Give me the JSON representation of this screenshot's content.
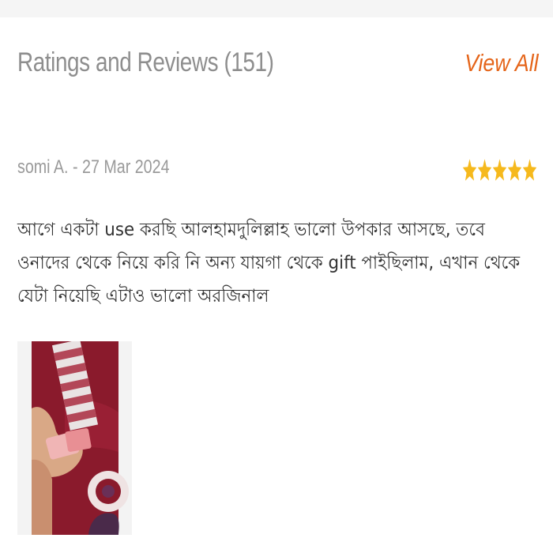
{
  "reviews_section": {
    "title": "Ratings and Reviews (151)",
    "view_all_label": "View All"
  },
  "review": {
    "reviewer_line": "somi A. - 27 Mar 2024",
    "rating": 5,
    "rating_max": 5,
    "star_color": "#f6b91c",
    "text": "আগে একটা use করছি আলহামদুলিল্লাহ ভালো উপকার আসছে, তবে ওনাদের থেকে নিয়ে করি নি অন্য যায়গা থেকে gift পাইছিলাম, এখান থেকে যেটা নিয়েছি এটাও ভালো অরজিনাল"
  },
  "colors": {
    "accent": "#e5651a",
    "muted_text": "#8e8e8e",
    "body_text": "#333333"
  }
}
